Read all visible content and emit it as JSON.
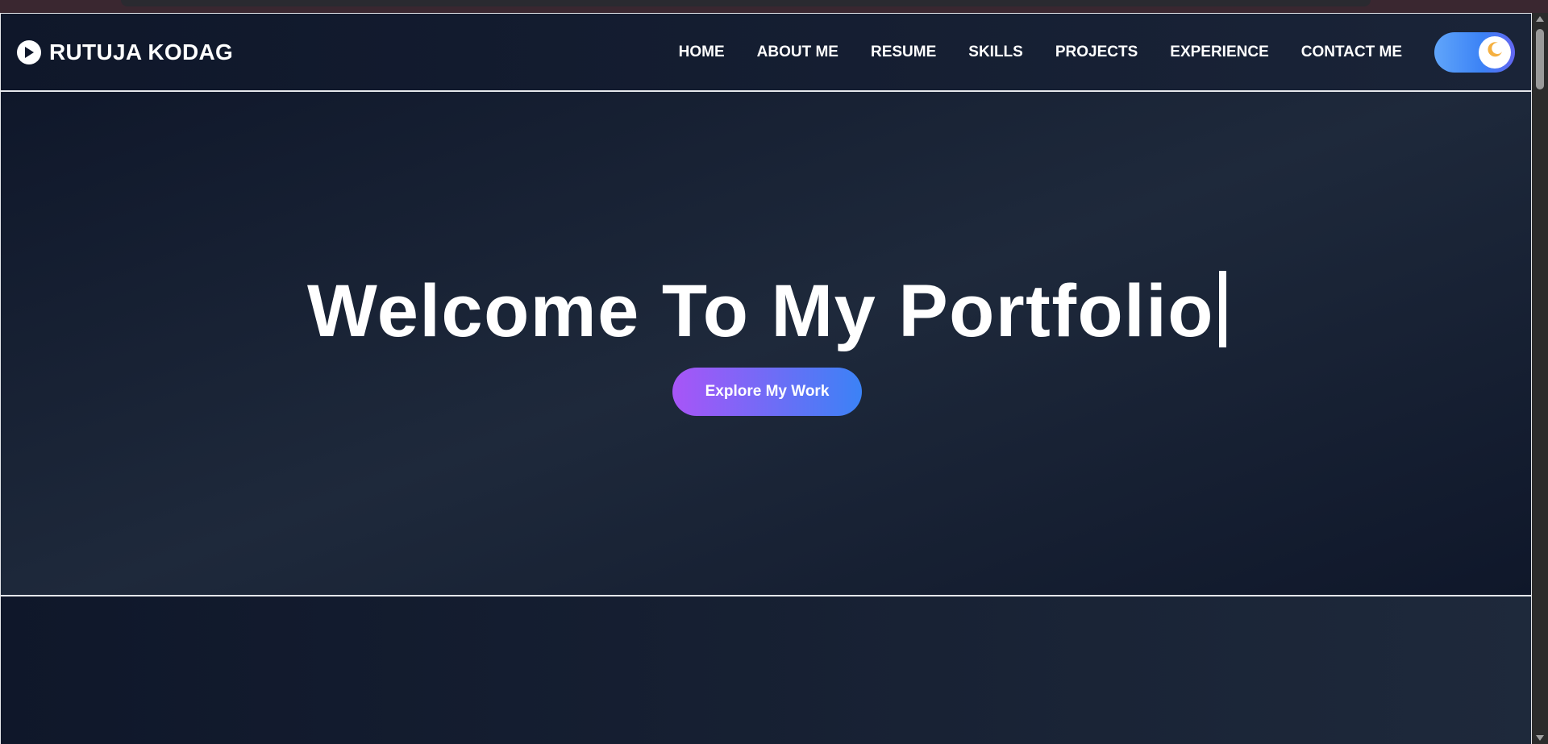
{
  "brand": {
    "name": "RUTUJA KODAG",
    "icon": "play-circle-icon"
  },
  "nav": {
    "items": [
      {
        "label": "HOME"
      },
      {
        "label": "ABOUT ME"
      },
      {
        "label": "RESUME"
      },
      {
        "label": "SKILLS"
      },
      {
        "label": "PROJECTS"
      },
      {
        "label": "EXPERIENCE"
      },
      {
        "label": "CONTACT ME"
      }
    ],
    "theme_toggle": {
      "icon": "moon-icon",
      "state": "dark"
    }
  },
  "hero": {
    "title": "Welcome To My Portfolio",
    "cta_label": "Explore My Work"
  },
  "colors": {
    "background": "#0f172a",
    "accent_purple": "#a855f7",
    "accent_blue": "#3b82f6",
    "moon": "#f5b041"
  }
}
